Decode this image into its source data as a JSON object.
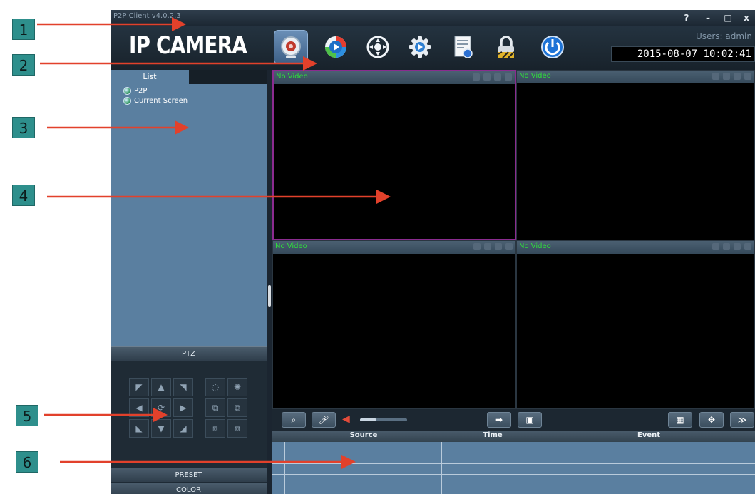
{
  "window": {
    "title": "P2P Client v4.0.2.3",
    "controls": {
      "help": "?",
      "minimize": "–",
      "maximize": "□",
      "close": "x"
    }
  },
  "header": {
    "brand": "IP CAMERA",
    "users_label": "Users: admin",
    "datetime": "2015-08-07 10:02:41",
    "toolbar_icons": [
      "live-view-icon",
      "playback-icon",
      "ptz-control-icon",
      "settings-icon",
      "log-icon",
      "lock-icon",
      "power-icon"
    ]
  },
  "left_panel": {
    "list_tab": "List",
    "tree": [
      "P2P",
      "Current Screen"
    ],
    "ptz_header": "PTZ",
    "preset_header": "PRESET",
    "color_header": "COLOR"
  },
  "video": {
    "panes": [
      {
        "label": "No Video",
        "selected": true
      },
      {
        "label": "No Video",
        "selected": false
      },
      {
        "label": "No Video",
        "selected": false
      },
      {
        "label": "No Video",
        "selected": false
      }
    ],
    "volume_level": 0.35
  },
  "events_table": {
    "columns": [
      "Source",
      "Time",
      "Event"
    ],
    "rows": []
  },
  "annotations": [
    "1",
    "2",
    "3",
    "4",
    "5",
    "6"
  ],
  "colors": {
    "callout": "#2e8f8c",
    "arrow": "#e2412b",
    "panel": "#5a7fa0",
    "no_video_text": "#2ee03a",
    "selected_border": "#8b2b8f"
  }
}
